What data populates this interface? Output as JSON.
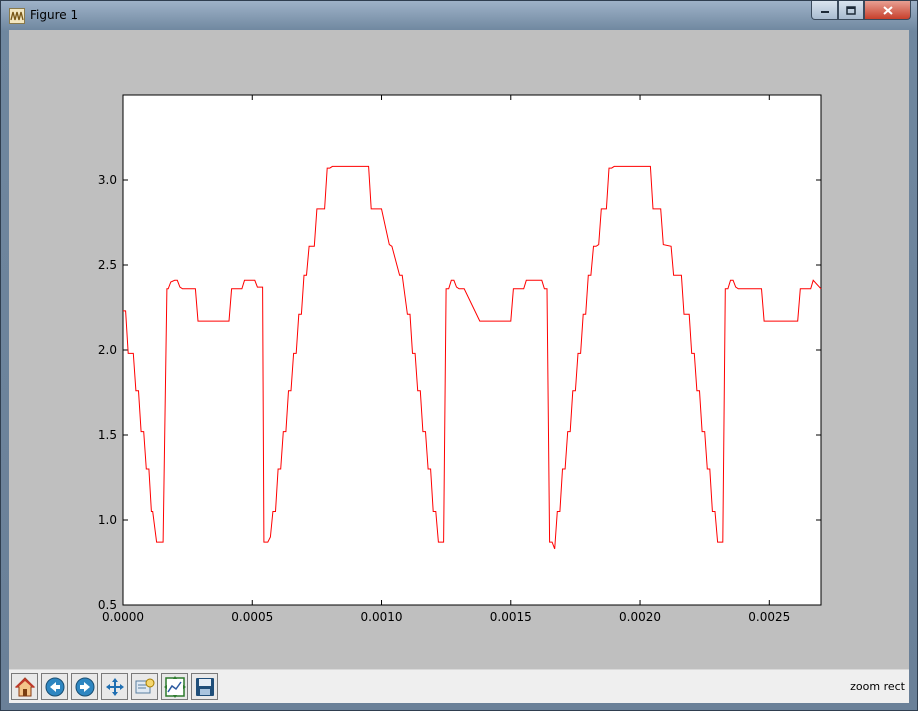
{
  "window": {
    "title": "Figure 1"
  },
  "toolbar": {
    "buttons": [
      "home-icon",
      "back-icon",
      "forward-icon",
      "pan-icon",
      "zoom-icon",
      "subplots-icon",
      "save-icon"
    ],
    "status": "zoom rect"
  },
  "colors": {
    "line": "#ff0000",
    "figure_bg": "#bfbfbf",
    "axes_bg": "#ffffff"
  },
  "chart_data": {
    "type": "line",
    "xlim": [
      0,
      0.0027
    ],
    "ylim": [
      0.5,
      3.5
    ],
    "xticks": [
      0.0,
      0.0005,
      0.001,
      0.0015,
      0.002,
      0.0025
    ],
    "xtick_labels": [
      "0.0000",
      "0.0005",
      "0.0010",
      "0.0015",
      "0.0020",
      "0.0025"
    ],
    "yticks": [
      0.5,
      1.0,
      1.5,
      2.0,
      2.5,
      3.0
    ],
    "ytick_labels": [
      "0.5",
      "1.0",
      "1.5",
      "2.0",
      "2.5",
      "3.0"
    ],
    "grid": false,
    "series": [
      {
        "color": "#ff0000",
        "x": [
          0.0,
          1e-05,
          2e-05,
          4e-05,
          5e-05,
          6e-05,
          7e-05,
          8e-05,
          9e-05,
          0.0001,
          0.00011,
          0.000115,
          0.00013,
          0.000135,
          0.00015,
          0.000155,
          0.00017,
          0.000175,
          0.000185,
          0.0002,
          0.00021,
          0.00022,
          0.00023,
          0.00024,
          0.00028,
          0.00029,
          0.00041,
          0.00042,
          0.00046,
          0.00047,
          0.00051,
          0.00052,
          0.00054,
          0.000545,
          0.00056,
          0.00057,
          0.00058,
          0.00059,
          0.0006,
          0.00061,
          0.00062,
          0.00063,
          0.00064,
          0.00065,
          0.00066,
          0.00067,
          0.00068,
          0.00069,
          0.0007,
          0.00071,
          0.00072,
          0.00073,
          0.00074,
          0.00075,
          0.00076,
          0.00077,
          0.00078,
          0.00079,
          0.0008,
          0.00081,
          0.00084,
          0.00085,
          0.00095,
          0.00096,
          0.00099,
          0.001,
          0.00103,
          0.00104,
          0.00107,
          0.00108,
          0.0011,
          0.00111,
          0.00112,
          0.00113,
          0.00114,
          0.00115,
          0.00116,
          0.00117,
          0.00118,
          0.00119,
          0.0012,
          0.00121,
          0.00122,
          0.00123,
          0.00124,
          0.00125,
          0.00126,
          0.00127,
          0.00128,
          0.00129,
          0.0013,
          0.00131,
          0.00132,
          0.00138,
          0.00139,
          0.0015,
          0.00151,
          0.00155,
          0.00156,
          0.00162,
          0.00163,
          0.00164,
          0.00165,
          0.00166,
          0.00167,
          0.00168,
          0.00169,
          0.0017,
          0.00171,
          0.00172,
          0.00173,
          0.00174,
          0.00175,
          0.00176,
          0.00177,
          0.00178,
          0.00179,
          0.0018,
          0.00181,
          0.00182,
          0.00183,
          0.00184,
          0.00185,
          0.00186,
          0.00187,
          0.00188,
          0.00189,
          0.0019,
          0.00193,
          0.00194,
          0.00204,
          0.00205,
          0.00208,
          0.00209,
          0.00212,
          0.00213,
          0.00216,
          0.00217,
          0.00219,
          0.0022,
          0.00221,
          0.00222,
          0.00223,
          0.00224,
          0.00225,
          0.00226,
          0.00227,
          0.00228,
          0.00229,
          0.0023,
          0.00231,
          0.00232,
          0.00233,
          0.00234,
          0.00235,
          0.00236,
          0.00237,
          0.00238,
          0.00239,
          0.0024,
          0.00241,
          0.00247,
          0.00248,
          0.00261,
          0.00262,
          0.00266,
          0.00267,
          0.0027
        ],
        "y": [
          2.23,
          2.23,
          1.98,
          1.98,
          1.76,
          1.76,
          1.52,
          1.52,
          1.3,
          1.3,
          1.05,
          1.05,
          0.87,
          0.87,
          0.87,
          0.87,
          2.36,
          2.36,
          2.4,
          2.41,
          2.41,
          2.37,
          2.36,
          2.36,
          2.36,
          2.17,
          2.17,
          2.36,
          2.36,
          2.41,
          2.41,
          2.37,
          2.37,
          0.87,
          0.87,
          0.9,
          1.05,
          1.05,
          1.3,
          1.3,
          1.52,
          1.52,
          1.76,
          1.76,
          1.98,
          1.98,
          2.21,
          2.21,
          2.44,
          2.44,
          2.61,
          2.61,
          2.61,
          2.83,
          2.83,
          2.83,
          2.83,
          3.07,
          3.07,
          3.08,
          3.08,
          3.08,
          3.08,
          2.83,
          2.83,
          2.83,
          2.62,
          2.61,
          2.44,
          2.44,
          2.21,
          2.21,
          1.98,
          1.98,
          1.76,
          1.76,
          1.52,
          1.52,
          1.3,
          1.3,
          1.05,
          1.05,
          0.87,
          0.87,
          0.87,
          2.36,
          2.36,
          2.41,
          2.41,
          2.37,
          2.36,
          2.36,
          2.36,
          2.17,
          2.17,
          2.17,
          2.36,
          2.36,
          2.41,
          2.41,
          2.36,
          2.36,
          0.87,
          0.87,
          0.83,
          1.05,
          1.05,
          1.3,
          1.3,
          1.52,
          1.52,
          1.76,
          1.76,
          1.98,
          1.98,
          2.21,
          2.21,
          2.44,
          2.44,
          2.61,
          2.61,
          2.62,
          2.83,
          2.83,
          2.83,
          3.07,
          3.07,
          3.08,
          3.08,
          3.08,
          3.08,
          2.83,
          2.83,
          2.62,
          2.61,
          2.44,
          2.44,
          2.21,
          2.21,
          1.98,
          1.98,
          1.76,
          1.76,
          1.52,
          1.52,
          1.3,
          1.3,
          1.05,
          1.05,
          0.87,
          0.87,
          0.87,
          2.36,
          2.36,
          2.41,
          2.41,
          2.37,
          2.36,
          2.36,
          2.36,
          2.36,
          2.36,
          2.17,
          2.17,
          2.36,
          2.36,
          2.41,
          2.36
        ]
      }
    ]
  }
}
